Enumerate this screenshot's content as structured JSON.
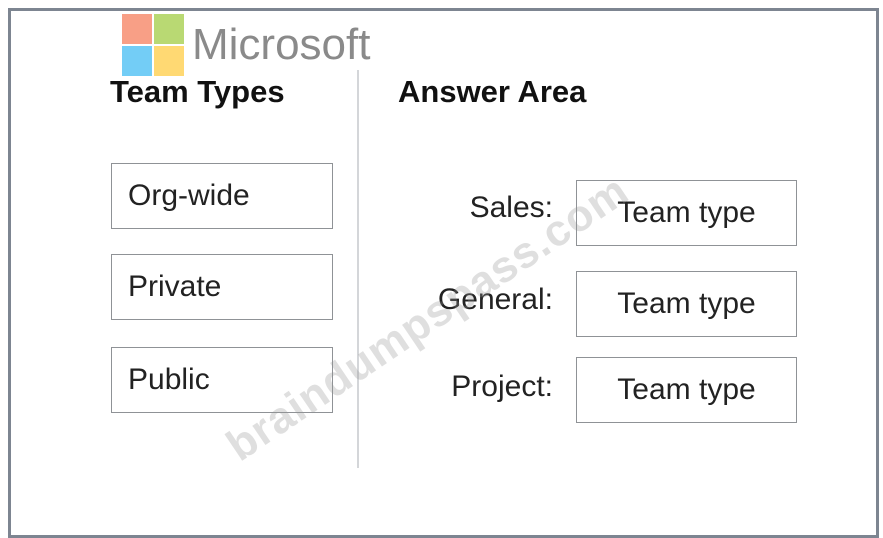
{
  "logo": {
    "text": "Microsoft",
    "colors": [
      "#f25022",
      "#7fba00",
      "#00a4ef",
      "#ffb900"
    ]
  },
  "team_types": {
    "heading": "Team Types",
    "items": [
      "Org-wide",
      "Private",
      "Public"
    ]
  },
  "answer_area": {
    "heading": "Answer Area",
    "rows": [
      {
        "label": "Sales:",
        "slot": "Team type"
      },
      {
        "label": "General:",
        "slot": "Team type"
      },
      {
        "label": "Project:",
        "slot": "Team type"
      }
    ]
  },
  "watermark": "braindumpspass.com",
  "colors": {
    "frame_border": "#7d8591",
    "divider": "#d4d6d9",
    "tile_border": "#8f9296"
  }
}
